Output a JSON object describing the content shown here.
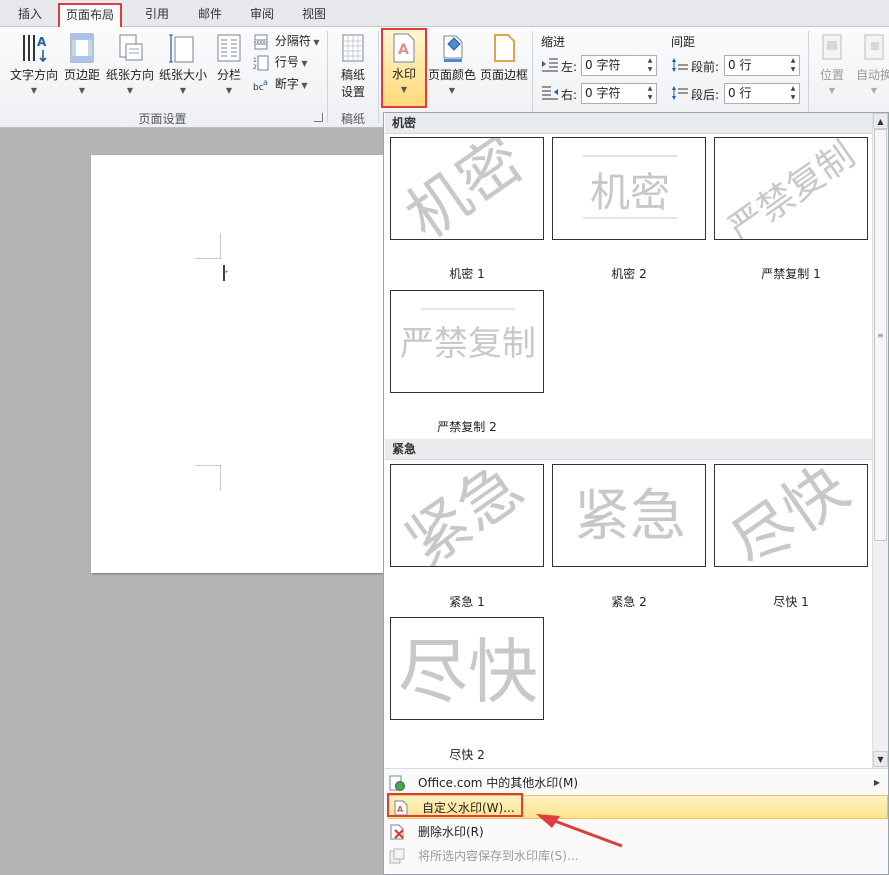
{
  "tabs": [
    {
      "label": "插入",
      "active": false
    },
    {
      "label": "页面布局",
      "active": true
    },
    {
      "label": "引用",
      "active": false
    },
    {
      "label": "邮件",
      "active": false
    },
    {
      "label": "审阅",
      "active": false
    },
    {
      "label": "视图",
      "active": false
    }
  ],
  "ribbon": {
    "page_setup": {
      "text_direction": "文字方向",
      "margins": "页边距",
      "orientation": "纸张方向",
      "size": "纸张大小",
      "columns": "分栏",
      "breaks": "分隔符",
      "line_numbers": "行号",
      "hyphenation": "断字",
      "group_label": "页面设置"
    },
    "manuscript": {
      "button_line1": "稿纸",
      "button_line2": "设置",
      "group_label": "稿纸"
    },
    "page_background": {
      "watermark": "水印",
      "page_color": "页面颜色",
      "page_borders": "页面边框"
    },
    "paragraph": {
      "indent_title": "缩进",
      "left_label": "左:",
      "left_value": "0 字符",
      "right_label": "右:",
      "right_value": "0 字符",
      "spacing_title": "间距",
      "before_label": "段前:",
      "before_value": "0 行",
      "after_label": "段后:",
      "after_value": "0 行"
    },
    "arrange": {
      "position": "位置",
      "wrap_text": "自动换"
    }
  },
  "gallery": {
    "sections": [
      {
        "title": "机密",
        "items": [
          {
            "caption": "机密 1",
            "watermark_text": "机密",
            "style": "diagonal"
          },
          {
            "caption": "机密 2",
            "watermark_text": "机密",
            "style": "horizontal"
          },
          {
            "caption": "严禁复制 1",
            "watermark_text": "严禁复制",
            "style": "diagonal"
          },
          {
            "caption": "严禁复制 2",
            "watermark_text": "严禁复制",
            "style": "horizontal"
          }
        ]
      },
      {
        "title": "紧急",
        "items": [
          {
            "caption": "紧急 1",
            "watermark_text": "紧急",
            "style": "diagonal"
          },
          {
            "caption": "紧急 2",
            "watermark_text": "紧急",
            "style": "horizontal"
          },
          {
            "caption": "尽快 1",
            "watermark_text": "尽快",
            "style": "diagonal"
          },
          {
            "caption": "尽快 2",
            "watermark_text": "尽快",
            "style": "horizontal"
          }
        ]
      }
    ]
  },
  "menu": {
    "office_com": "Office.com 中的其他水印(M)",
    "custom": "自定义水印(W)...",
    "remove": "删除水印(R)",
    "save_selection": "将所选内容保存到水印库(S)..."
  },
  "colors": {
    "highlight_red": "#e23b3b",
    "menu_hover": "#fde38b",
    "watermark_gray": "#c8c8c8"
  }
}
